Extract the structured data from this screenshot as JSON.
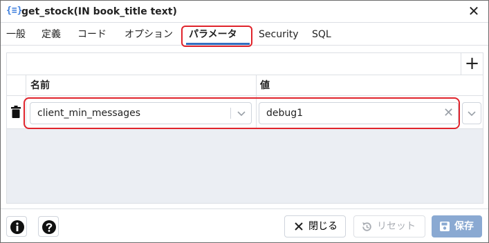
{
  "dialog": {
    "icon_text": "{≡}",
    "title": "get_stock(IN book_title text)",
    "close_glyph": "✕"
  },
  "tabs": [
    {
      "label": "一般"
    },
    {
      "label": "定義"
    },
    {
      "label": "コード"
    },
    {
      "label": "オプション"
    },
    {
      "label": "パラメータ",
      "active": true
    },
    {
      "label": "Security"
    },
    {
      "label": "SQL"
    }
  ],
  "table": {
    "add_glyph": "+",
    "columns": [
      "名前",
      "値"
    ],
    "rows": [
      {
        "name": "client_min_messages",
        "value": "debug1"
      }
    ]
  },
  "footer": {
    "close_label": "閉じる",
    "close_glyph": "✕",
    "reset_label": "リセット",
    "save_label": "保存"
  },
  "colors": {
    "accent": "#326fc0",
    "highlight": "#e0232b",
    "save_disabled_bg": "#8aa9d2",
    "content_bg": "#ebeef3"
  }
}
